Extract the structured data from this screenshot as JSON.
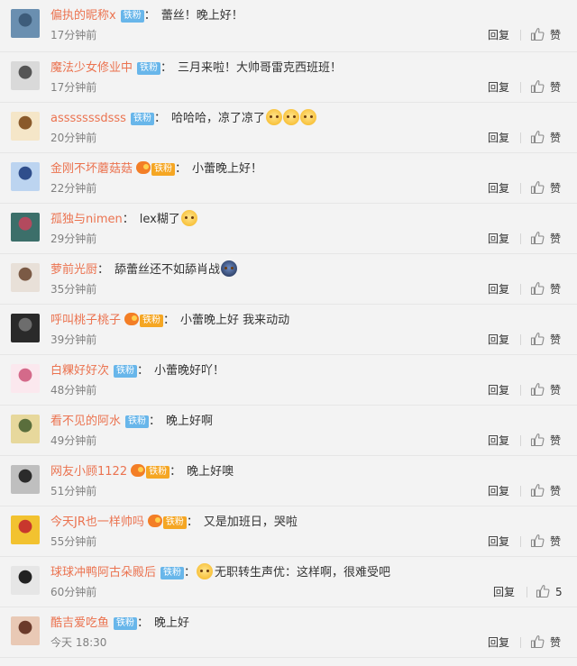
{
  "comments": [
    {
      "user": "偏执的昵称x",
      "badge": "铁粉",
      "vip": false,
      "text": "蕾丝！晚上好！",
      "emoji": [],
      "time": "17分钟前",
      "reply": "回复",
      "like": "赞",
      "avatar_colors": [
        "#6a8fb0",
        "#3d5c7a"
      ]
    },
    {
      "user": "魔法少女修业中",
      "badge": "铁粉",
      "vip": false,
      "text": "三月来啦！大帅哥雷克西班班！",
      "emoji": [],
      "time": "17分钟前",
      "reply": "回复",
      "like": "赞",
      "avatar_colors": [
        "#d9d9d9",
        "#555555"
      ]
    },
    {
      "user": "asssssssdsss",
      "badge": "铁粉",
      "vip": false,
      "text": "哈哈哈，凉了凉了",
      "emoji": [
        "doge",
        "doge",
        "doge"
      ],
      "time": "20分钟前",
      "reply": "回复",
      "like": "赞",
      "avatar_colors": [
        "#f5e6c8",
        "#8a5a2b"
      ]
    },
    {
      "user": "金刚不坏蘑菇菇",
      "badge": "铁粉",
      "vip": true,
      "text": "小蕾晚上好！",
      "emoji": [],
      "time": "22分钟前",
      "reply": "回复",
      "like": "赞",
      "avatar_colors": [
        "#bcd4f0",
        "#2f4e8c"
      ]
    },
    {
      "user": "孤独与nimen",
      "badge": "",
      "vip": false,
      "text": "lex糊了",
      "emoji": [
        "shy"
      ],
      "time": "29分钟前",
      "reply": "回复",
      "like": "赞",
      "avatar_colors": [
        "#3c6f6a",
        "#b34a5e"
      ]
    },
    {
      "user": "萝前光厨",
      "badge": "",
      "vip": false,
      "text": "舔蕾丝还不如舔肖战",
      "emoji": [
        "dark"
      ],
      "time": "35分钟前",
      "reply": "回复",
      "like": "赞",
      "avatar_colors": [
        "#e8e0d8",
        "#7b5a45"
      ]
    },
    {
      "user": "呼叫桃子桃子",
      "badge": "铁粉",
      "vip": true,
      "text": "小蕾晚上好 我来动动",
      "emoji": [],
      "time": "39分钟前",
      "reply": "回复",
      "like": "赞",
      "avatar_colors": [
        "#2a2a2a",
        "#6d6d6d"
      ]
    },
    {
      "user": "白粿好好次",
      "badge": "铁粉",
      "vip": false,
      "text": "小蕾晚好吖！",
      "emoji": [],
      "time": "48分钟前",
      "reply": "回复",
      "like": "赞",
      "avatar_colors": [
        "#fbe8ee",
        "#d46a8a"
      ]
    },
    {
      "user": "看不见的阿水",
      "badge": "铁粉",
      "vip": false,
      "text": "晚上好啊",
      "emoji": [],
      "time": "49分钟前",
      "reply": "回复",
      "like": "赞",
      "avatar_colors": [
        "#e7d89c",
        "#5a6e3c"
      ]
    },
    {
      "user": "网友小顾1122",
      "badge": "铁粉",
      "vip": true,
      "text": "晚上好噢",
      "emoji": [],
      "time": "51分钟前",
      "reply": "回复",
      "like": "赞",
      "avatar_colors": [
        "#bfbfbf",
        "#2b2b2b"
      ]
    },
    {
      "user": "今天JR也一样帅吗",
      "badge": "铁粉",
      "vip": true,
      "text": "又是加班日，哭啦",
      "emoji": [],
      "time": "55分钟前",
      "reply": "回复",
      "like": "赞",
      "avatar_colors": [
        "#f2c230",
        "#c8372d"
      ]
    },
    {
      "user": "球球冲鸭阿古朵殿后",
      "badge": "铁粉",
      "vip": false,
      "text": "无职转生声优：这样啊，很难受吧",
      "emoji_before": true,
      "emoji": [
        "doge"
      ],
      "time": "60分钟前",
      "reply": "回复",
      "like": "5",
      "avatar_colors": [
        "#e6e6e6",
        "#222222"
      ]
    },
    {
      "user": "酷吉爱吃鱼",
      "badge": "铁粉",
      "vip": false,
      "text": "晚上好",
      "emoji": [],
      "time": "今天 18:30",
      "reply": "回复",
      "like": "赞",
      "avatar_colors": [
        "#e9c9b5",
        "#6b3a2a"
      ]
    }
  ],
  "colon": "："
}
